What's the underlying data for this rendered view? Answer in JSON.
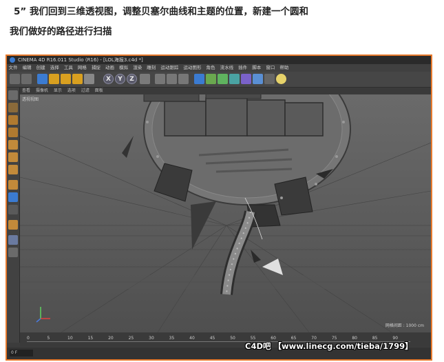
{
  "instructions": {
    "line1": "5” 我们回到三维透视图，调整贝塞尔曲线和主题的位置，新建一个圆和",
    "line2": "我们做好的路径进行扫描"
  },
  "app": {
    "title": "CINEMA 4D R16.011 Studio (R16) - [LOL海报3.c4d *]",
    "menu": [
      "文件",
      "编辑",
      "创建",
      "选择",
      "工具",
      "网格",
      "捕捉",
      "动画",
      "模拟",
      "渲染",
      "雕刻",
      "运动跟踪",
      "运动图形",
      "角色",
      "流水线",
      "插件",
      "脚本",
      "窗口",
      "帮助"
    ],
    "toolbar_axes": [
      "X",
      "Y",
      "Z"
    ],
    "view_menu": [
      "查看",
      "摄像机",
      "显示",
      "选项",
      "过滤",
      "面板"
    ],
    "viewport_label": "透视视图",
    "grid_spacing": "网格间距 : 1000 cm",
    "timeline_ticks": [
      "0",
      "5",
      "10",
      "15",
      "20",
      "25",
      "30",
      "35",
      "40",
      "45",
      "50",
      "55",
      "60",
      "65",
      "70",
      "75",
      "80",
      "85",
      "90"
    ],
    "frame_value": "0 F",
    "watermark": "C4D吧 【www.linecg.com/tieba/1799】"
  },
  "colors": {
    "frame_border": "#e87a2c",
    "accent_blue": "#3b7bd1"
  }
}
